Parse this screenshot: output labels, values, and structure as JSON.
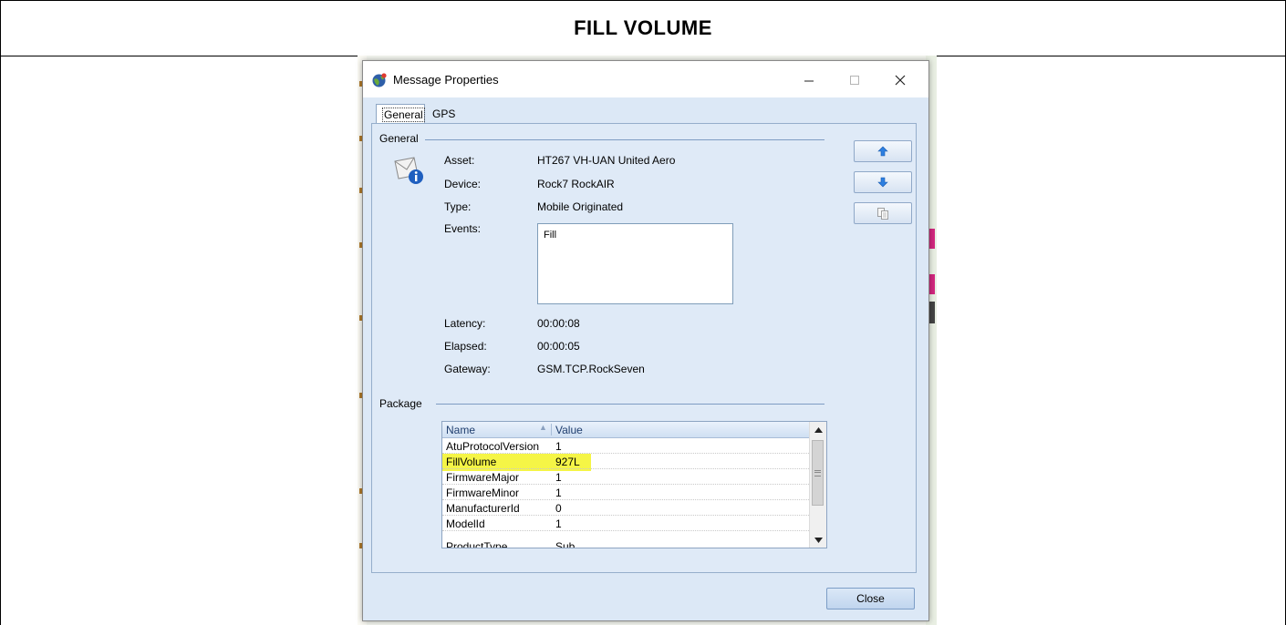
{
  "document": {
    "header_title": "FILL VOLUME"
  },
  "dialog": {
    "title": "Message Properties",
    "window_controls": {
      "minimize": "–",
      "maximize": "□",
      "close": "✕"
    },
    "tabs": [
      {
        "label": "General",
        "active": true
      },
      {
        "label": "GPS",
        "active": false
      }
    ],
    "general_group": {
      "label": "General",
      "fields": [
        {
          "label": "Asset:",
          "value": "HT267 VH-UAN United Aero"
        },
        {
          "label": "Device:",
          "value": "Rock7 RockAIR"
        },
        {
          "label": "Type:",
          "value": "Mobile Originated"
        },
        {
          "label": "Events:",
          "value": "Fill"
        },
        {
          "label": "Latency:",
          "value": "00:00:08"
        },
        {
          "label": "Elapsed:",
          "value": "00:00:05"
        },
        {
          "label": "Gateway:",
          "value": "GSM.TCP.RockSeven"
        }
      ],
      "icon": "envelope-info-icon"
    },
    "side_buttons": [
      {
        "icon": "arrow-up-icon"
      },
      {
        "icon": "arrow-down-icon"
      },
      {
        "icon": "copy-icon"
      }
    ],
    "package_group": {
      "label": "Package",
      "columns": [
        "Name",
        "Value"
      ],
      "rows": [
        {
          "name": "AtuProtocolVersion",
          "value": "1"
        },
        {
          "name": "FillVolume",
          "value": "927L",
          "highlighted": true
        },
        {
          "name": "FirmwareMajor",
          "value": "1"
        },
        {
          "name": "FirmwareMinor",
          "value": "1"
        },
        {
          "name": "ManufacturerId",
          "value": "0"
        },
        {
          "name": "ModelId",
          "value": "1"
        },
        {
          "name": "ProductType",
          "value": "Sub"
        }
      ]
    },
    "close_label": "Close"
  },
  "colors": {
    "dialog_bg": "#dce8f6",
    "highlight": "#f5f546",
    "group_line": "#7e9cc3",
    "arrow_blue": "#2d7fe0"
  }
}
